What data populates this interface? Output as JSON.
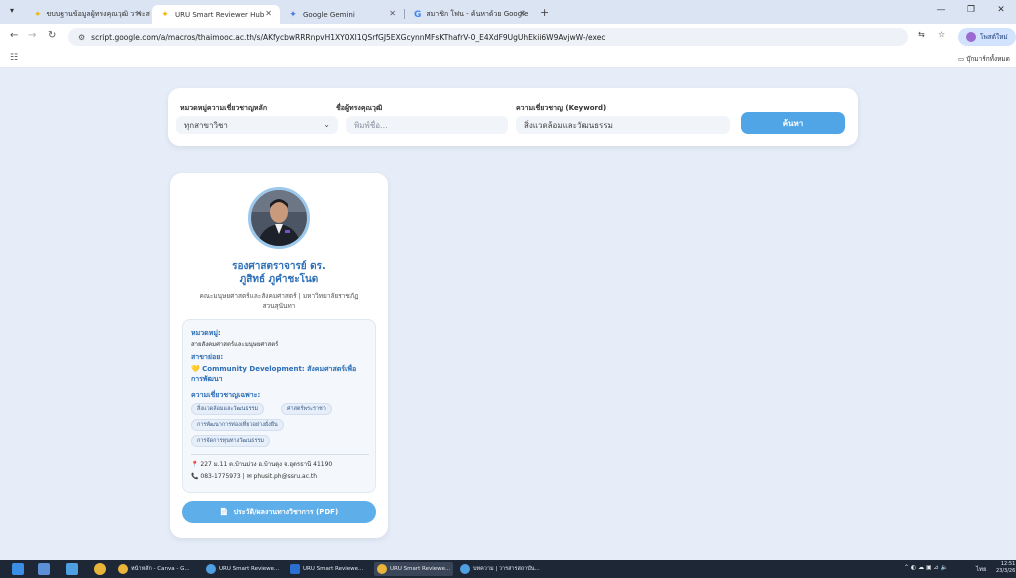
{
  "browser": {
    "tabs": [
      {
        "title": "ขบบฐานข้อมูลผู้ทรงคุณวุฒิ วาระสา...",
        "active": false
      },
      {
        "title": "URU Smart Reviewer Hub",
        "active": true
      },
      {
        "title": "Google Gemini",
        "active": false
      },
      {
        "title": "สมาชิก โฟน - ค้นหาด้วย Google",
        "active": false
      }
    ],
    "url": "script.google.com/a/macros/thaimooc.ac.th/s/AKfycbwRRRnpvH1XY0XI1QSrfGJ5EXGcynnMFsKThafrV-0_E4XdF9UgUhEkii6W9AvjwW-/exec",
    "profile_label": "โพสต์ใหม่",
    "bookmark_folder": "บุ๊กมาร์กทั้งหมด"
  },
  "search": {
    "category_label": "หมวดหมู่ความเชี่ยวชาญหลัก",
    "category_value": "ทุกสาขาวิชา",
    "name_label": "ชื่อผู้ทรงคุณวุฒิ",
    "name_placeholder": "พิมพ์ชื่อ...",
    "keyword_label": "ความเชี่ยวชาญ (Keyword)",
    "keyword_value": "สิ่งแวดล้อมและวัฒนธรรม",
    "button_label": "ค้นหา"
  },
  "reviewer": {
    "name_line1": "รองศาสตราจารย์ ดร.",
    "name_line2": "ภูสิทธ์ ภูคำชะโนด",
    "faculty_line1": "คณะมนุษยศาสตร์และสังคมศาสตร์ | มหาวิทยาลัยราชภัฏ",
    "faculty_line2": "สวนสุนันทา",
    "category_label": "หมวดหมู่:",
    "category_value": "สายสังคมศาสตร์และมนุษยศาสตร์",
    "subfield_label": "สาขาย่อย:",
    "subfield_value": "💛 Community Development: สังคมศาสตร์เพื่อการพัฒนา",
    "expertise_label": "ความเชี่ยวชาญเฉพาะ:",
    "expertise": [
      "สิ่งแวดล้อมและวัฒนธรรม",
      "ศาสตร์พระราชา",
      "การพัฒนาการท่องเที่ยวอย่างยั่งยืน",
      "การจัดการทุนทางวัฒนธรรม"
    ],
    "address": "227 ม.11 ต.บ้านม่วง อ.บ้านดุง จ.อุดรธานี 41190",
    "contact": "083-1775973 | ✉ phusit.ph@ssru.ac.th",
    "cv_button": "ประวัติ/ผลงานทางวิชาการ (PDF)"
  },
  "taskbar": {
    "apps": [
      "หน้าหลัก - Canva - G...",
      "URU Smart Reviewe...",
      "URU Smart Reviewe...",
      "URU Smart Reviewe...",
      "บทความ | วารสารสถาบัน..."
    ],
    "tray_text": "ไทย",
    "time": "12:51",
    "date": "23/3/26"
  }
}
